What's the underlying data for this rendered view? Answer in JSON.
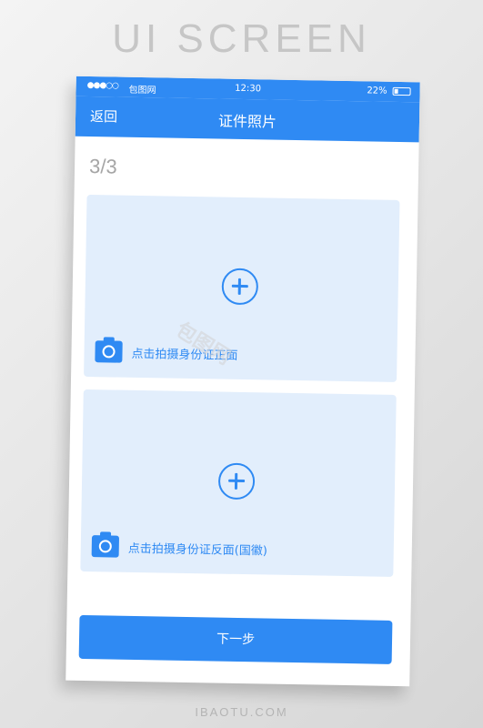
{
  "banner": {
    "title": "UI SCREEN"
  },
  "status_bar": {
    "signal": "●●●○○",
    "carrier": "包图网",
    "time": "12:30",
    "battery": "22%",
    "battery_level": 0.22
  },
  "nav": {
    "back_label": "返回",
    "title": "证件照片"
  },
  "step": {
    "counter": "3/3"
  },
  "cards": [
    {
      "label": "点击拍摄身份证正面"
    },
    {
      "label": "点击拍摄身份证反面(国徽)"
    }
  ],
  "next_button": {
    "label": "下一步"
  },
  "watermark": {
    "text": "包图网"
  },
  "footer": {
    "brand": "IBAOTU.COM"
  },
  "colors": {
    "accent": "#2f8af3",
    "card_bg": "#e2eefc",
    "background": "#e6e6e6"
  },
  "icons": [
    "plus-circle-icon",
    "camera-icon",
    "battery-icon",
    "signal-icon"
  ]
}
